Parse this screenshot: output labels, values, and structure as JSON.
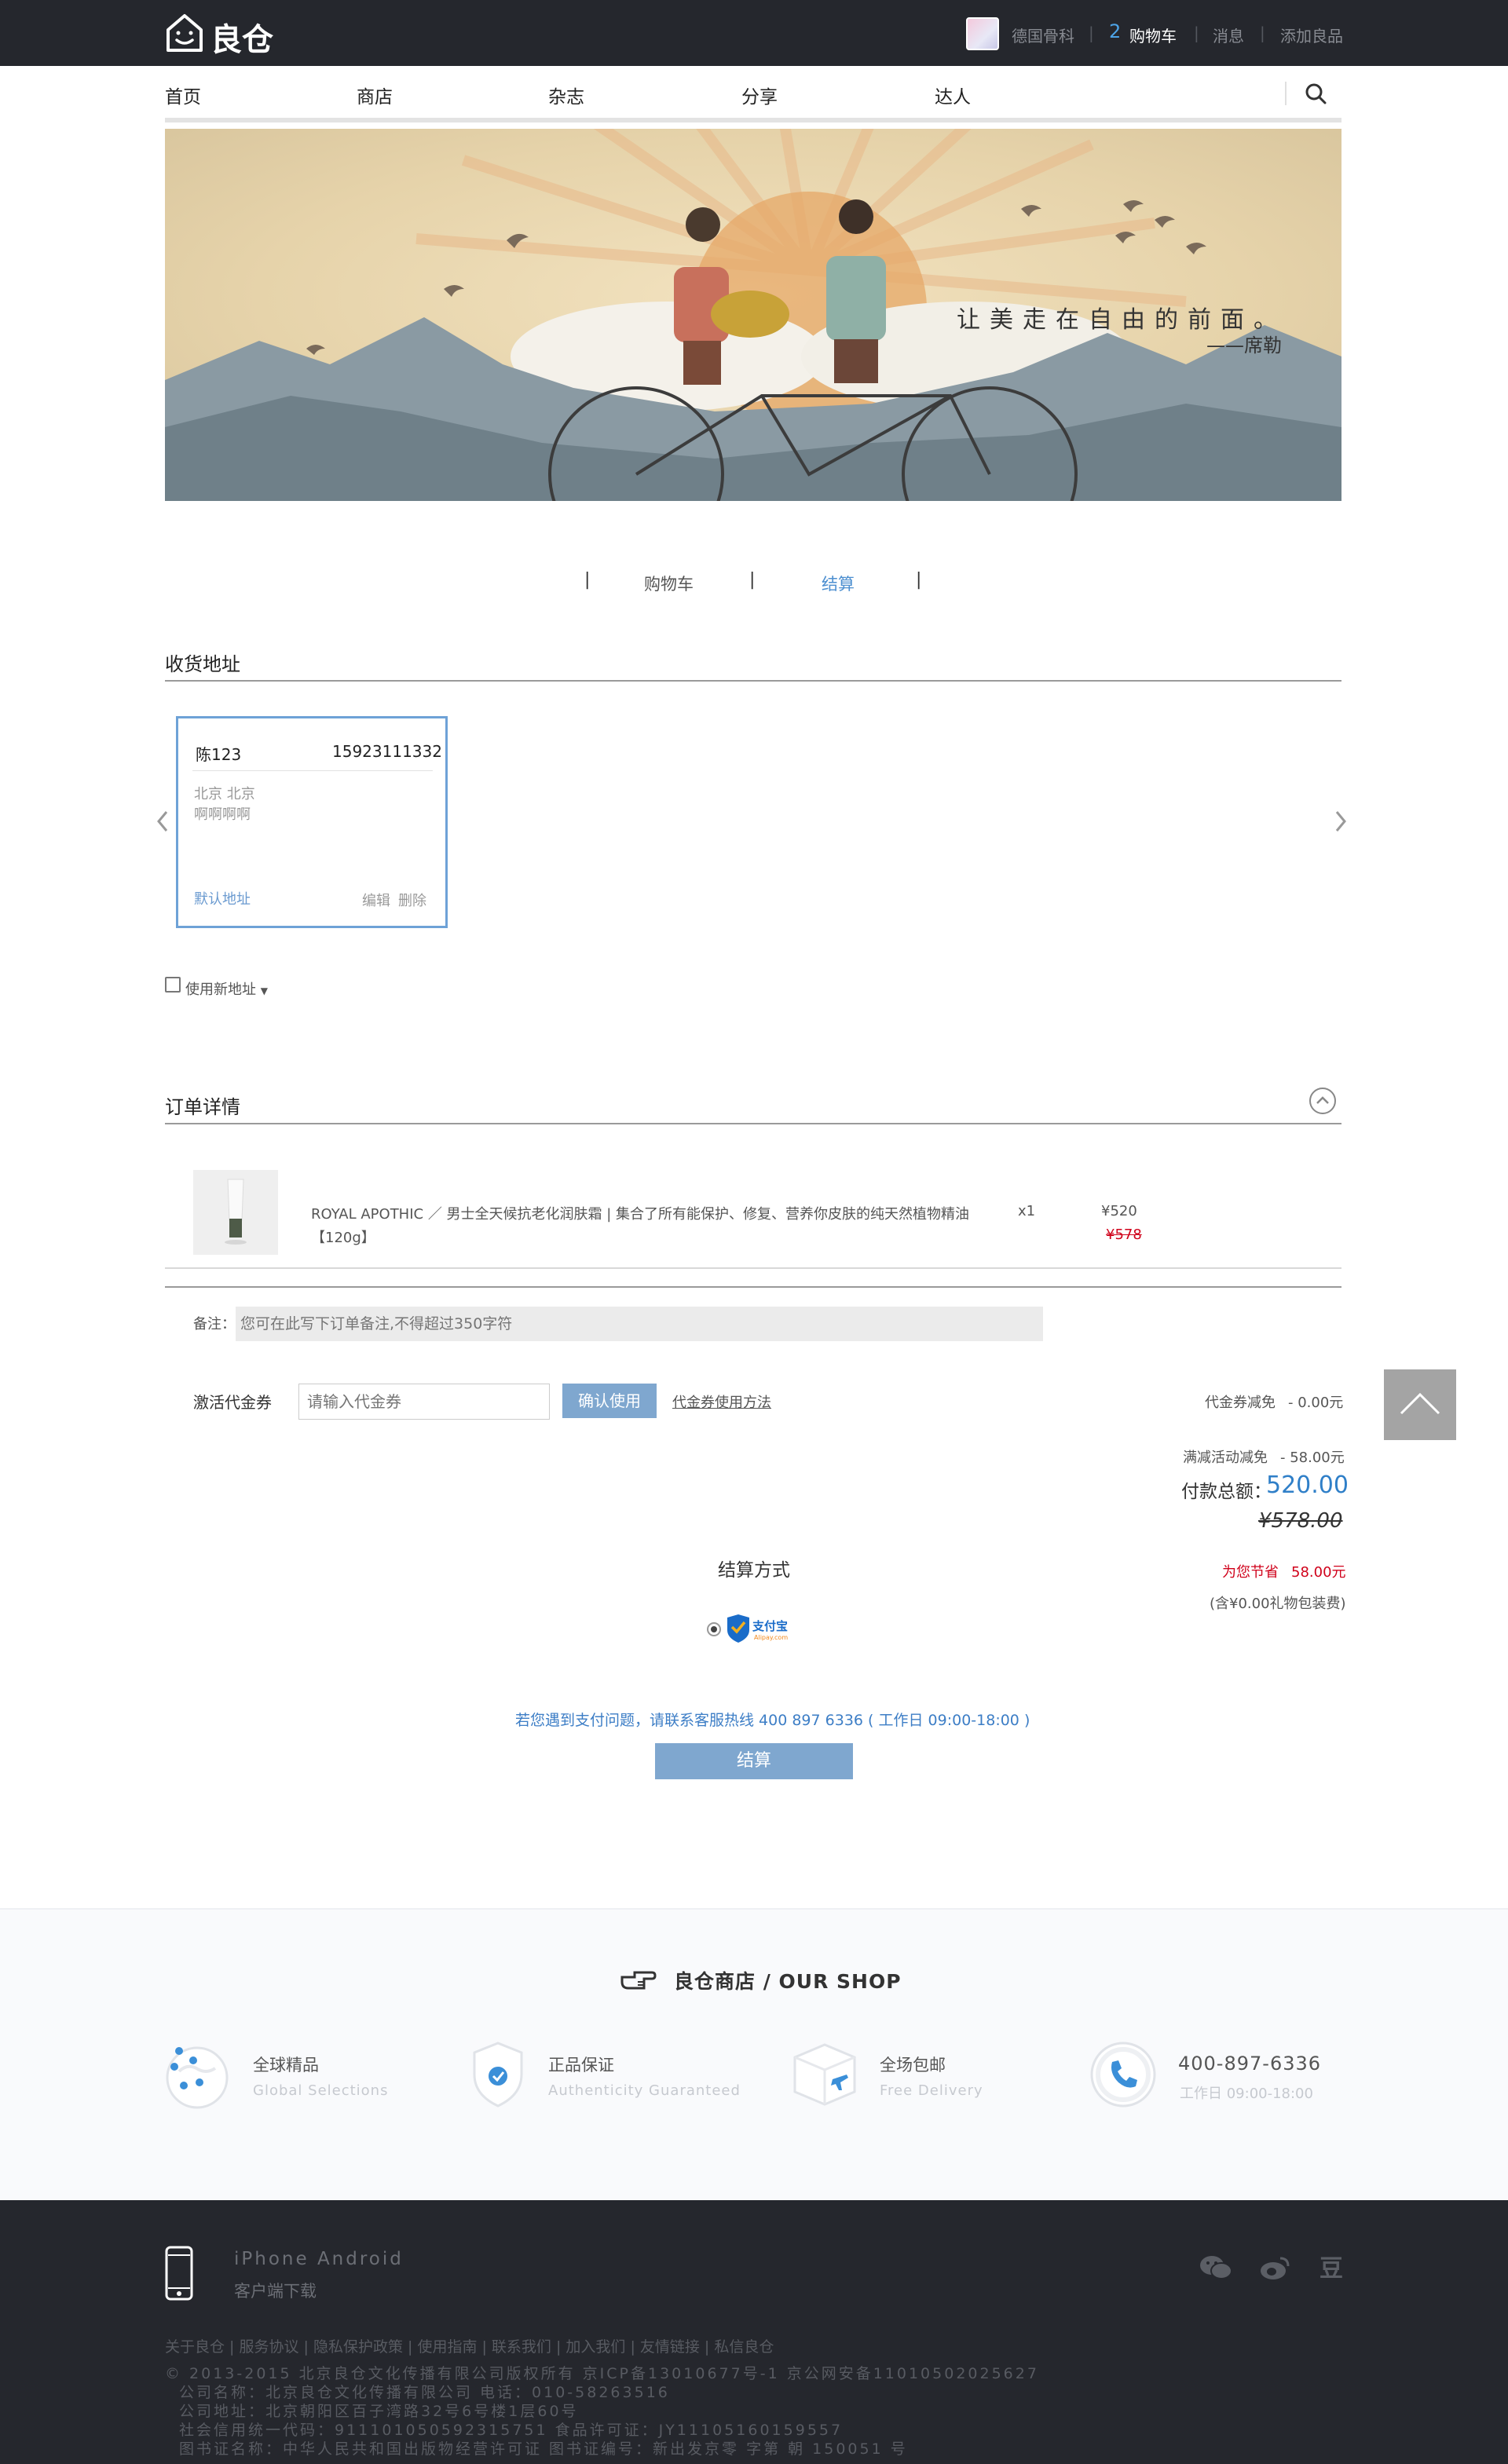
{
  "header": {
    "logo_text": "良仓",
    "user_name": "德国骨科",
    "cart_count": "2",
    "cart_label": "购物车",
    "messages_label": "消息",
    "add_item_label": "添加良品",
    "separator": "|"
  },
  "nav": {
    "items": [
      "首页",
      "商店",
      "杂志",
      "分享",
      "达人"
    ]
  },
  "banner": {
    "quote": "让美走在自由的前面。",
    "author": "——席勒"
  },
  "steps": {
    "separator": "|",
    "cart": "购物车",
    "checkout": "结算"
  },
  "address_section": {
    "title": "收货地址",
    "card": {
      "name": "陈123",
      "phone": "15923111332",
      "city": "北京 北京",
      "street": "啊啊啊啊",
      "default_label": "默认地址",
      "edit_label": "编辑",
      "delete_label": "删除"
    },
    "new_address_label": "使用新地址",
    "new_address_checked": false
  },
  "order_section": {
    "title": "订单详情",
    "item": {
      "name": "ROYAL APOTHIC ／ 男士全天候抗老化润肤霜 | 集合了所有能保护、修复、营养你皮肤的纯天然植物精油",
      "spec": "【120g】",
      "qty": "x1",
      "price": "¥520",
      "original_price": "¥578"
    },
    "remark_label": "备注：",
    "remark_placeholder": "您可在此写下订单备注,不得超过350字符",
    "coupon_label": "激活代金券",
    "coupon_placeholder": "请输入代金券",
    "coupon_button": "确认使用",
    "coupon_help": "代金券使用方法"
  },
  "summary": {
    "coupon_discount_label": "代金券减免",
    "coupon_discount_value": "- 0.00元",
    "promo_discount_label": "满减活动减免",
    "promo_discount_value": "- 58.00元",
    "total_label": "付款总额：",
    "total_value": "520.00",
    "original_total": "¥578.00",
    "saved_label": "为您节省",
    "saved_value": "58.00元",
    "wrap_note": "(含¥0.00礼物包装费)"
  },
  "payment": {
    "title": "结算方式",
    "method": "支付宝",
    "method_sub": "Alipay.com",
    "help_text": "若您遇到支付问题，请联系客服热线 400 897 6336 ( 工作日 09:00-18:00 )",
    "submit_label": "结算"
  },
  "shop": {
    "title": "良仓商店 / OUR SHOP",
    "features": [
      {
        "title": "全球精品",
        "subtitle": "Global Selections",
        "icon": "globe-pin-icon"
      },
      {
        "title": "正品保证",
        "subtitle": "Authenticity Guaranteed",
        "icon": "shield-check-icon"
      },
      {
        "title": "全场包邮",
        "subtitle": "Free Delivery",
        "icon": "box-plane-icon"
      }
    ],
    "phone": "400-897-6336",
    "phone_hours": "工作日 09:00-18:00"
  },
  "footer": {
    "app_title": "iPhone Android",
    "app_subtitle": "客户端下载",
    "links": "关于良仓 | 服务协议 | 隐私保护政策 | 使用指南 | 联系我们 | 加入我们 | 友情链接 | 私信良仓",
    "legal": [
      "© 2013-2015 北京良仓文化传播有限公司版权所有 京ICP备13010677号-1 京公网安备11010502025627",
      "公司名称：北京良仓文化传播有限公司  电话：010-58263516",
      "公司地址：北京朝阳区百子湾路32号6号楼1层60号",
      "社会信用统一代码：911101050592315751  食品许可证：JY11105160159557",
      "图书证名称：中华人民共和国出版物经营许可证  图书证编号：新出发京零 字第 朝 150051 号"
    ],
    "social_douban": "豆"
  },
  "colors": {
    "topbar": "#25272d",
    "accent_blue": "#4d8fd0",
    "button_blue": "#7fa7cf",
    "price_red": "#d0021b"
  }
}
